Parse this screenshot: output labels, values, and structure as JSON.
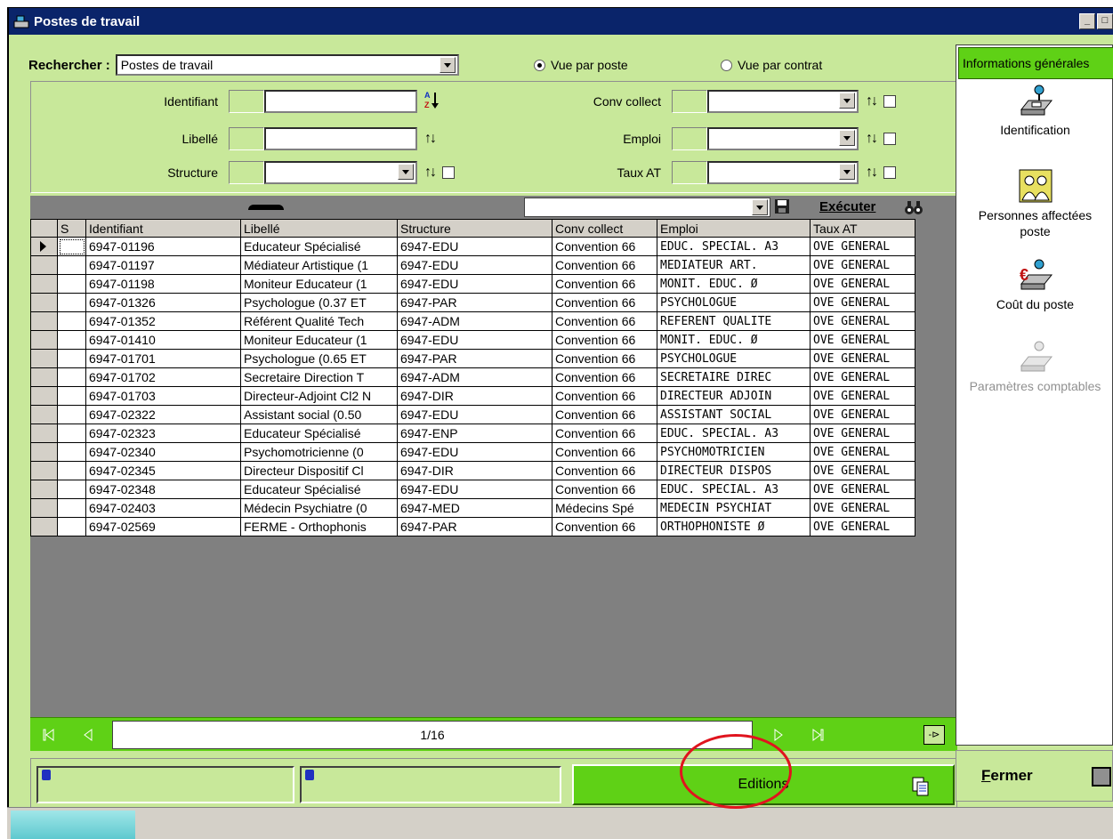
{
  "window": {
    "title": "Postes de travail"
  },
  "search": {
    "label": "Rechercher :",
    "selected": "Postes de travail"
  },
  "view_mode": {
    "options": [
      "Vue par poste",
      "Vue par contrat"
    ],
    "selected": "Vue par poste"
  },
  "filters": {
    "identifiant": "Identifiant",
    "libelle": "Libellé",
    "structure": "Structure",
    "conv_collect": "Conv collect",
    "emploi": "Emploi",
    "taux_at": "Taux AT"
  },
  "toolbar": {
    "execute": "Exécuter"
  },
  "table": {
    "columns": [
      "S",
      "Identifiant",
      "Libellé",
      "Structure",
      "Conv collect",
      "Emploi",
      "Taux AT"
    ],
    "rows": [
      [
        "",
        "6947-01196",
        "Educateur Spécialisé",
        "6947-EDU",
        "Convention 66",
        "EDUC. SPECIAL. A3",
        "OVE GENERAL"
      ],
      [
        "",
        "6947-01197",
        "Médiateur Artistique (1",
        "6947-EDU",
        "Convention 66",
        "MEDIATEUR ART.",
        "OVE GENERAL"
      ],
      [
        "",
        "6947-01198",
        "Moniteur Educateur (1",
        "6947-EDU",
        "Convention 66",
        "MONIT. EDUC. Ø",
        "OVE GENERAL"
      ],
      [
        "",
        "6947-01326",
        "Psychologue (0.37 ET",
        "6947-PAR",
        "Convention 66",
        "PSYCHOLOGUE",
        "OVE GENERAL"
      ],
      [
        "",
        "6947-01352",
        "Référent Qualité Tech",
        "6947-ADM",
        "Convention 66",
        "REFERENT QUALITE",
        "OVE GENERAL"
      ],
      [
        "",
        "6947-01410",
        "Moniteur Educateur (1",
        "6947-EDU",
        "Convention 66",
        "MONIT. EDUC. Ø",
        "OVE GENERAL"
      ],
      [
        "",
        "6947-01701",
        "Psychologue (0.65 ET",
        "6947-PAR",
        "Convention 66",
        "PSYCHOLOGUE",
        "OVE GENERAL"
      ],
      [
        "",
        "6947-01702",
        "Secretaire Direction T",
        "6947-ADM",
        "Convention 66",
        "SECRETAIRE DIREC",
        "OVE GENERAL"
      ],
      [
        "",
        "6947-01703",
        "Directeur-Adjoint Cl2 N",
        "6947-DIR",
        "Convention 66",
        "DIRECTEUR ADJOIN",
        "OVE GENERAL"
      ],
      [
        "",
        "6947-02322",
        "Assistant social (0.50",
        "6947-EDU",
        "Convention 66",
        "ASSISTANT SOCIAL",
        "OVE GENERAL"
      ],
      [
        "",
        "6947-02323",
        "Educateur Spécialisé",
        "6947-ENP",
        "Convention 66",
        "EDUC. SPECIAL. A3",
        "OVE GENERAL"
      ],
      [
        "",
        "6947-02340",
        "Psychomotricienne (0",
        "6947-EDU",
        "Convention 66",
        "PSYCHOMOTRICIEN",
        "OVE GENERAL"
      ],
      [
        "",
        "6947-02345",
        "Directeur Dispositif Cl",
        "6947-DIR",
        "Convention 66",
        "DIRECTEUR DISPOS",
        "OVE GENERAL"
      ],
      [
        "",
        "6947-02348",
        "Educateur Spécialisé",
        "6947-EDU",
        "Convention 66",
        "EDUC. SPECIAL. A3",
        "OVE GENERAL"
      ],
      [
        "",
        "6947-02403",
        "Médecin Psychiatre (0",
        "6947-MED",
        "Médecins Spé",
        "MEDECIN PSYCHIAT",
        "OVE GENERAL"
      ],
      [
        "",
        "6947-02569",
        "FERME - Orthophonis",
        "6947-PAR",
        "Convention 66",
        "ORTHOPHONISTE Ø",
        "OVE GENERAL"
      ]
    ]
  },
  "navigator": {
    "position": "1/16"
  },
  "actions": {
    "editions": "Editions"
  },
  "side_panel": {
    "header": "Informations générales",
    "items": [
      {
        "label_lines": [
          "Identification"
        ],
        "enabled": true,
        "icon": "identification-icon"
      },
      {
        "label_lines": [
          "Personnes affectées",
          "poste"
        ],
        "enabled": true,
        "icon": "people-icon"
      },
      {
        "label_lines": [
          "Coût du poste"
        ],
        "enabled": true,
        "icon": "cost-icon"
      },
      {
        "label_lines": [
          "Paramètres comptables"
        ],
        "enabled": false,
        "icon": "accounting-icon"
      }
    ]
  },
  "close": {
    "label_first": "F",
    "label_rest": "ermer"
  },
  "colors": {
    "panel": "#c8e89a",
    "accent": "#5fd116",
    "title_bar": "#0a246a",
    "annotation": "#e0141e"
  }
}
